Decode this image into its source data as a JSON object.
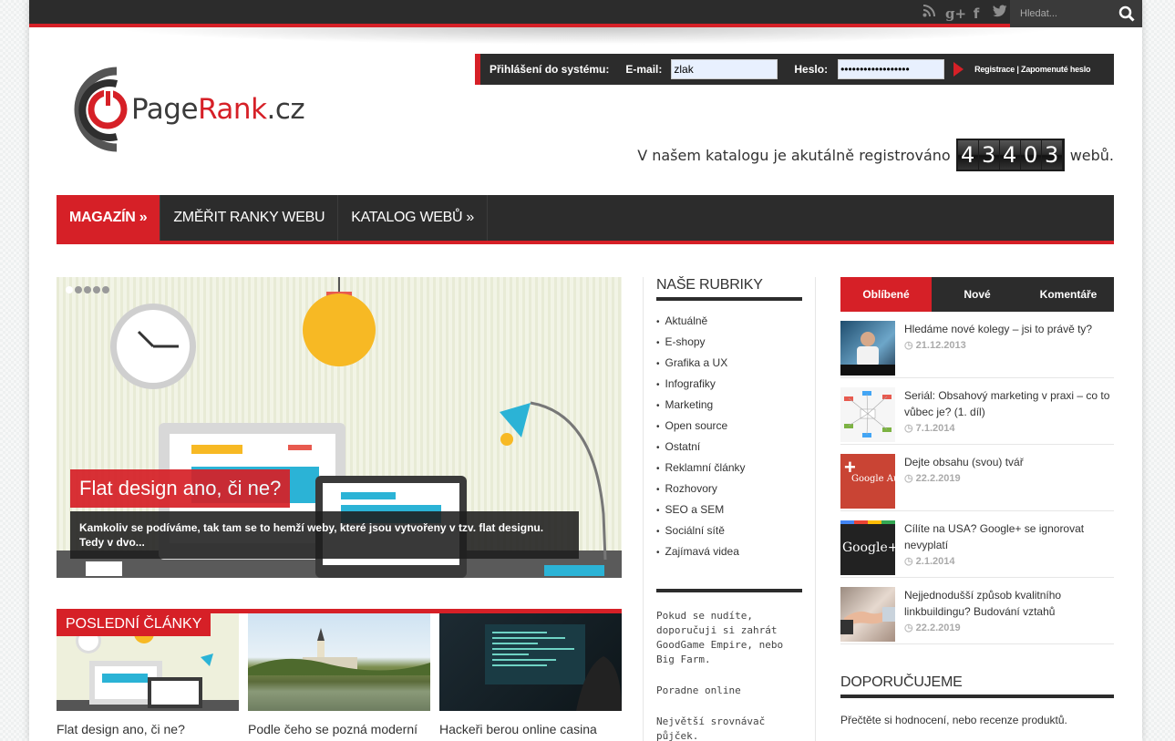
{
  "topbar": {
    "social": [
      "rss-icon",
      "google-plus-icon",
      "facebook-icon",
      "twitter-icon"
    ],
    "search_placeholder": "Hledat..."
  },
  "logo": {
    "name_main": "Page",
    "name_red": "Rank",
    "name_tld": ".cz"
  },
  "login": {
    "title": "Přihlášení do systému:",
    "email_label": "E-mail:",
    "email_value": "zlak",
    "password_label": "Heslo:",
    "password_value": "••••••••••••••••••",
    "links": "Registrace | Zapomenuté heslo"
  },
  "counter": {
    "prefix": "V našem katalogu je akutálně registrováno",
    "digits": [
      "4",
      "3",
      "4",
      "0",
      "3"
    ],
    "suffix": "webů."
  },
  "nav": [
    "MAGAZÍN »",
    "ZMĚŘIT RANKY WEBU",
    "KATALOG WEBŮ »"
  ],
  "slider": {
    "title": "Flat design ano, či ne?",
    "excerpt": "Kamkoliv se podíváme, tak tam se to hemží weby, které jsou vytvořeny v tzv. flat designu. Tedy v dvo..."
  },
  "last_articles": {
    "label": "POSLEDNÍ ČLÁNKY",
    "items": [
      "Flat design ano, či ne?",
      "Podle čeho se pozná moderní",
      "Hackeři berou online casina"
    ]
  },
  "categories": {
    "title": "NAŠE RUBRIKY",
    "items": [
      "Aktuálně",
      "E-shopy",
      "Grafika a UX",
      "Infografiky",
      "Marketing",
      "Open source",
      "Ostatní",
      "Reklamní články",
      "Rozhovory",
      "SEO a SEM",
      "Sociální sítě",
      "Zajímavá videa"
    ],
    "promo1": "Pokud se nudíte, doporučuji si zahrát GoodGame Empire, nebo Big Farm.",
    "promo2": "Poradne online",
    "promo3": "Největší srovnávač půjček."
  },
  "sidebar": {
    "tabs": [
      "Oblíbené",
      "Nové",
      "Komentáře"
    ],
    "posts": [
      {
        "title": "Hledáme nové kolegy – jsi to právě ty?",
        "date": "21.12.2013"
      },
      {
        "title": "Seriál: Obsahový marketing v praxi – co to vůbec je? (1. díl)",
        "date": "7.1.2014"
      },
      {
        "title": "Dejte obsahu (svou) tvář",
        "date": "22.2.2019"
      },
      {
        "title": "Cílíte na USA? Google+ se ignorovat nevyplatí",
        "date": "2.1.2014"
      },
      {
        "title": "Nejjednodušší způsob kvalitního linkbuildingu? Budování vztahů",
        "date": "22.2.2019"
      }
    ],
    "recommend_title": "DOPORUČUJEME",
    "recommend_text": "Přečtěte si hodnocení, nebo recenze produktů.",
    "thumb_labels": [
      "Google Au",
      "Google+"
    ]
  }
}
